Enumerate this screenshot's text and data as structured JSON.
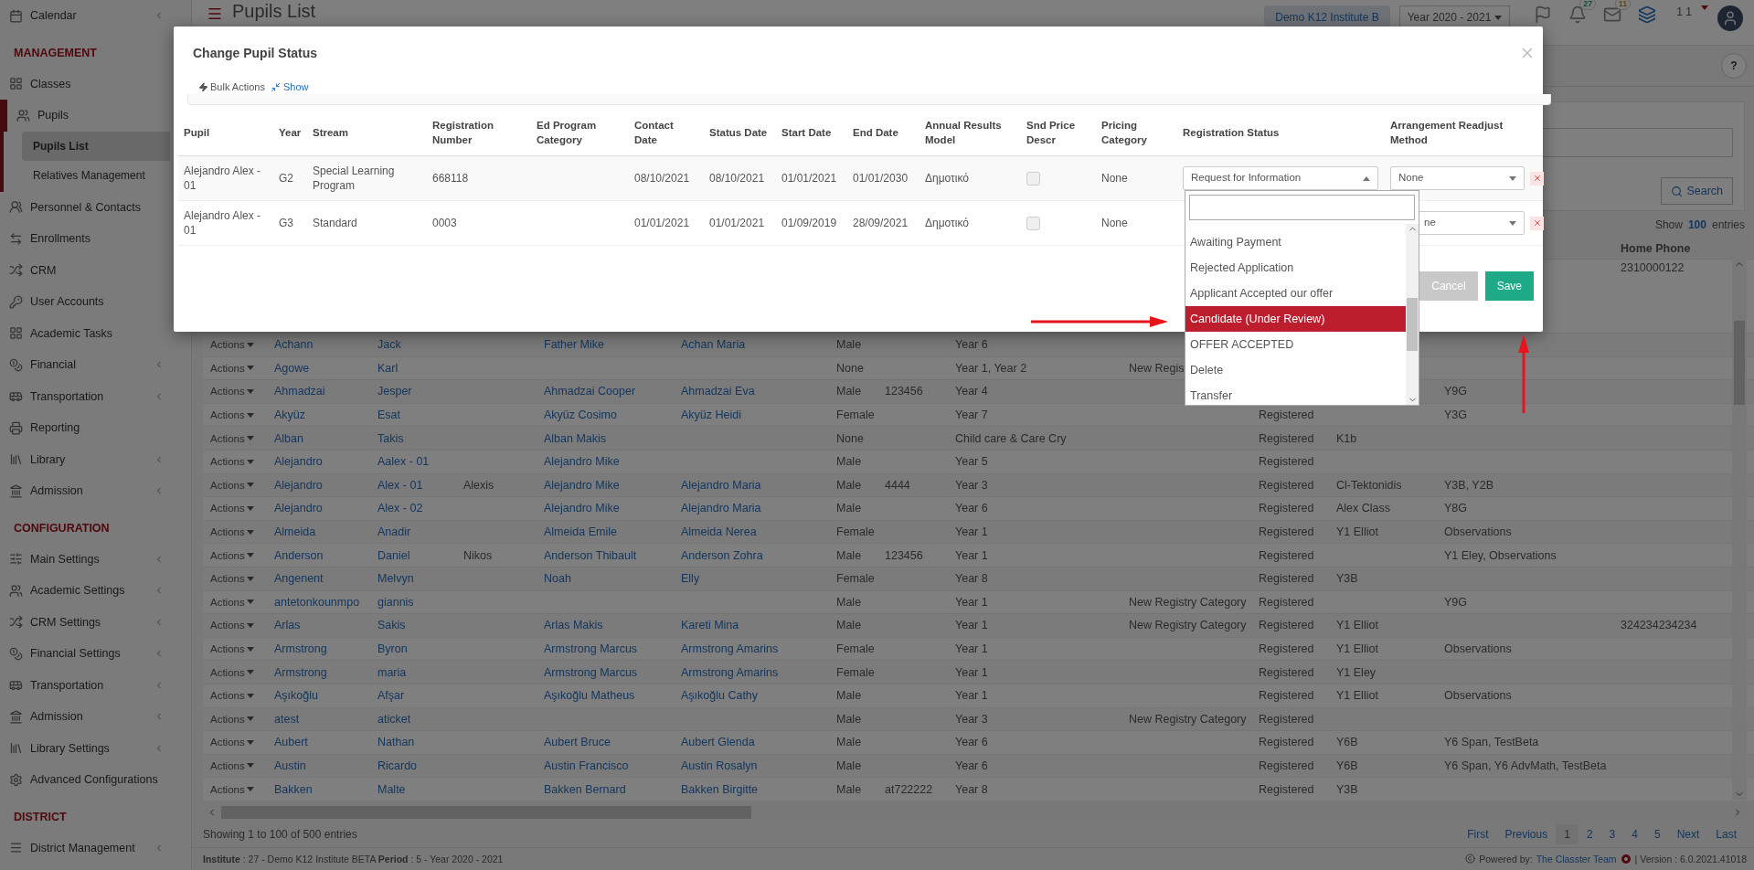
{
  "sidebar": {
    "entries": [
      {
        "kind": "item",
        "label": "Calendar",
        "submenu": true,
        "expanded": false
      },
      {
        "kind": "heading",
        "label": "MANAGEMENT"
      },
      {
        "kind": "item",
        "label": "Classes",
        "submenu": false,
        "expanded": false
      },
      {
        "kind": "item",
        "label": "Pupils",
        "submenu": false,
        "expanded": true,
        "children": [
          {
            "label": "Pupils List",
            "selected": true
          },
          {
            "label": "Relatives Management",
            "selected": false
          }
        ]
      },
      {
        "kind": "item",
        "label": "Personnel & Contacts",
        "submenu": false,
        "expanded": false
      },
      {
        "kind": "item",
        "label": "Enrollments",
        "submenu": false,
        "expanded": false
      },
      {
        "kind": "item",
        "label": "CRM",
        "submenu": false,
        "expanded": false
      },
      {
        "kind": "item",
        "label": "User Accounts",
        "submenu": false,
        "expanded": false
      },
      {
        "kind": "item",
        "label": "Academic Tasks",
        "submenu": false,
        "expanded": false
      },
      {
        "kind": "item",
        "label": "Financial",
        "submenu": true,
        "expanded": false
      },
      {
        "kind": "item",
        "label": "Transportation",
        "submenu": true,
        "expanded": false
      },
      {
        "kind": "item",
        "label": "Reporting",
        "submenu": false,
        "expanded": false
      },
      {
        "kind": "item",
        "label": "Library",
        "submenu": true,
        "expanded": false
      },
      {
        "kind": "item",
        "label": "Admission",
        "submenu": true,
        "expanded": false
      },
      {
        "kind": "heading",
        "label": "CONFIGURATION"
      },
      {
        "kind": "item",
        "label": "Main Settings",
        "submenu": true,
        "expanded": false
      },
      {
        "kind": "item",
        "label": "Academic Settings",
        "submenu": true,
        "expanded": false
      },
      {
        "kind": "item",
        "label": "CRM Settings",
        "submenu": true,
        "expanded": false
      },
      {
        "kind": "item",
        "label": "Financial Settings",
        "submenu": true,
        "expanded": false
      },
      {
        "kind": "item",
        "label": "Transportation",
        "submenu": true,
        "expanded": false
      },
      {
        "kind": "item",
        "label": "Admission",
        "submenu": true,
        "expanded": false
      },
      {
        "kind": "item",
        "label": "Library Settings",
        "submenu": true,
        "expanded": false
      },
      {
        "kind": "item",
        "label": "Advanced Configurations",
        "submenu": false,
        "expanded": false
      },
      {
        "kind": "heading",
        "label": "DISTRICT"
      },
      {
        "kind": "item",
        "label": "District Management",
        "submenu": true,
        "expanded": false
      }
    ]
  },
  "header": {
    "title": "Pupils List",
    "institute": "Demo K12 Institute B",
    "year": "Year 2020 - 2021",
    "notifications": "27",
    "messages": "11",
    "user": "1 1",
    "help": "?"
  },
  "search": {
    "button": "Search"
  },
  "page_size": {
    "prefix": "Show",
    "value": "100",
    "suffix": "entries"
  },
  "table": {
    "home_phone_heading": "Home Phone",
    "rows": [
      {
        "home_phone": "2310000122"
      },
      {
        "column_1": "Actions",
        "column_2": "Achann",
        "column_3": "Jack",
        "column_5": "Father Mike",
        "column_6": "Achan Maria",
        "column_7": "Male",
        "column_9": "Year 6"
      },
      {
        "column_1": "Actions",
        "column_2": "Agowe",
        "column_3": "Karl",
        "column_7": "None",
        "column_9": "Year 1, Year 2",
        "column_10": "New Regis"
      },
      {
        "column_1": "Actions",
        "column_2": "Ahmadzai",
        "column_3": "Jesper",
        "column_5": "Ahmadzai Cooper",
        "column_6": "Ahmadzai Eva",
        "column_7": "Male",
        "column_8": "123456",
        "column_9": "Year 4",
        "column_13": "Y9G"
      },
      {
        "column_1": "Actions",
        "column_2": "Akyüz",
        "column_3": "Esat",
        "column_5": "Akyüz Cosimo",
        "column_6": "Akyüz Heidi",
        "column_7": "Female",
        "column_9": "Year 7",
        "column_11": "Registered",
        "column_13": "Y3G"
      },
      {
        "column_1": "Actions",
        "column_2": "Alban",
        "column_3": "Takis",
        "column_5": "Alban Makis",
        "column_7": "None",
        "column_9": "Child care & Care Cry",
        "column_11": "Registered",
        "column_12": "K1b"
      },
      {
        "column_1": "Actions",
        "column_2": "Alejandro",
        "column_3": "Aalex - 01",
        "column_5": "Alejandro Mike",
        "column_7": "Male",
        "column_9": "Year 5",
        "column_11": "Registered"
      },
      {
        "column_1": "Actions",
        "column_2": "Alejandro",
        "column_3": "Alex - 01",
        "column_4": "Alexis",
        "column_5": "Alejandro Mike",
        "column_6": "Alejandro Maria",
        "column_7": "Male",
        "column_8": "4444",
        "column_9": "Year 3",
        "column_11": "Registered",
        "column_12": "Cl-Tektonidis",
        "column_13": "Y3B, Y2B"
      },
      {
        "column_1": "Actions",
        "column_2": "Alejandro",
        "column_3": "Alex - 02",
        "column_5": "Alejandro Mike",
        "column_6": "Alejandro Maria",
        "column_7": "Male",
        "column_9": "Year 6",
        "column_11": "Registered",
        "column_12": "Alex Class",
        "column_13": "Y8G"
      },
      {
        "column_1": "Actions",
        "column_2": "Almeida",
        "column_3": "Anadir",
        "column_5": "Almeida Emile",
        "column_6": "Almeida Nerea",
        "column_7": "Female",
        "column_9": "Year 1",
        "column_11": "Registered",
        "column_12": "Y1 Elliot",
        "column_13": "Observations"
      },
      {
        "column_1": "Actions",
        "column_2": "Anderson",
        "column_3": "Daniel",
        "column_4": "Nikos",
        "column_5": "Anderson Thibault",
        "column_6": "Anderson Zohra",
        "column_7": "Male",
        "column_8": "123456",
        "column_9": "Year 1",
        "column_11": "Registered",
        "column_13": "Y1 Eley, Observations"
      },
      {
        "column_1": "Actions",
        "column_2": "Angenent",
        "column_3": "Melvyn",
        "column_5": "Noah",
        "column_6": "Elly",
        "column_7": "Female",
        "column_9": "Year 8",
        "column_11": "Registered",
        "column_12": "Y3B"
      },
      {
        "column_1": "Actions",
        "column_2": "antetonkounmpo",
        "column_3": "giannis",
        "column_7": "Male",
        "column_9": "Year 1",
        "column_10": "New Registry Category",
        "column_11": "Registered",
        "column_13": "Y9G"
      },
      {
        "column_1": "Actions",
        "column_2": "Arlas",
        "column_3": "Sakis",
        "column_5": "Arlas Makis",
        "column_6": "Kareti Mina",
        "column_7": "Male",
        "column_9": "Year 1",
        "column_10": "New Registry Category",
        "column_11": "Registered",
        "column_12": "Y1 Elliot",
        "home_phone": "324234234234"
      },
      {
        "column_1": "Actions",
        "column_2": "Armstrong",
        "column_3": "Byron",
        "column_5": "Armstrong Marcus",
        "column_6": "Armstrong Amarins",
        "column_7": "Female",
        "column_9": "Year 1",
        "column_11": "Registered",
        "column_12": "Y1 Elliot",
        "column_13": "Observations"
      },
      {
        "column_1": "Actions",
        "column_2": "Armstrong",
        "column_3": "maria",
        "column_5": "Armstrong Marcus",
        "column_6": "Armstrong Amarins",
        "column_7": "Female",
        "column_9": "Year 1",
        "column_11": "Registered",
        "column_12": "Y1 Eley"
      },
      {
        "column_1": "Actions",
        "column_2": "Aşıkoğlu",
        "column_3": "Afşar",
        "column_5": "Aşıkoğlu Matheus",
        "column_6": "Aşıkoğlu Cathy",
        "column_7": "Male",
        "column_9": "Year 1",
        "column_11": "Registered",
        "column_12": "Y1 Elliot",
        "column_13": "Observations"
      },
      {
        "column_1": "Actions",
        "column_2": "atest",
        "column_3": "aticket",
        "column_7": "Male",
        "column_9": "Year 3",
        "column_10": "New Registry Category",
        "column_11": "Registered"
      },
      {
        "column_1": "Actions",
        "column_2": "Aubert",
        "column_3": "Nathan",
        "column_5": "Aubert Bruce",
        "column_6": "Aubert Glenda",
        "column_7": "Male",
        "column_9": "Year 6",
        "column_11": "Registered",
        "column_12": "Y6B",
        "column_13": "Y6 Span, TestBeta"
      },
      {
        "column_1": "Actions",
        "column_2": "Austin",
        "column_3": "Ricardo",
        "column_5": "Austin Francisco",
        "column_6": "Austin Rosalyn",
        "column_7": "Male",
        "column_9": "Year 6",
        "column_11": "Registered",
        "column_12": "Y6B",
        "column_13": "Y6 Span, Y6 AdvMath, TestBeta"
      },
      {
        "column_1": "Actions",
        "column_2": "Bakken",
        "column_3": "Malte",
        "column_5": "Bakken Bernard",
        "column_6": "Bakken Birgitte",
        "column_7": "Male",
        "column_8": "at722222",
        "column_9": "Year 8",
        "column_11": "Registered",
        "column_12": "Y3B"
      }
    ]
  },
  "entries_info": "Showing 1 to 100 of 500 entries",
  "pagination": [
    {
      "label": "First",
      "selected": false
    },
    {
      "label": "Previous",
      "selected": false
    },
    {
      "label": "1",
      "selected": true
    },
    {
      "label": "2",
      "selected": false
    },
    {
      "label": "3",
      "selected": false
    },
    {
      "label": "4",
      "selected": false
    },
    {
      "label": "5",
      "selected": false
    },
    {
      "label": "Next",
      "selected": false
    },
    {
      "label": "Last",
      "selected": false
    }
  ],
  "footer": {
    "left": "**Institute** : 27 - Demo K12 Institute BETA **Period** : 5 - Year 2020 - 2021",
    "powered_by": "Powered by:",
    "team": "The Classter Team",
    "version": "| Version : 6.0.2021.41018"
  },
  "modal": {
    "title": "Change Pupil Status",
    "bulk_actions": {
      "label": "Bulk Actions",
      "link": "Show"
    },
    "columns": [
      "Pupil",
      "Year",
      "Stream",
      "Registration Number",
      "Ed Program Category",
      "Contact Date",
      "Status Date",
      "Start Date",
      "End Date",
      "Annual Results Model",
      "Snd Price Descr",
      "Pricing Category",
      "Registration Status",
      "Arrangement Readjust Method"
    ],
    "rows": [
      {
        "pupil": "Alejandro Alex - 01",
        "year": "G2",
        "stream": "Special Learning Program",
        "registration_number": "668118",
        "contact_date": "08/10/2021",
        "status_date": "08/10/2021",
        "start_date": "01/01/2021",
        "end_date": "01/01/2030",
        "annual_results_model": "Δημοτικό",
        "snd_price_descr": false,
        "pricing_category": "None",
        "registration_status": {
          "value": "Request for Information",
          "expanded": true
        },
        "arrangement": "None"
      },
      {
        "pupil": "Alejandro Alex - 01",
        "year": "G3",
        "stream": "Standard",
        "registration_number": "0003",
        "contact_date": "01/01/2021",
        "status_date": "01/01/2021",
        "start_date": "01/09/2019",
        "end_date": "28/09/2021",
        "annual_results_model": "Δημοτικό",
        "snd_price_descr": false,
        "pricing_category": "None",
        "arrangement": "ne"
      }
    ],
    "dropdown": {
      "options": [
        {
          "label": "Awaiting Payment",
          "selected": false
        },
        {
          "label": "Rejected Application",
          "selected": false
        },
        {
          "label": "Applicant Accepted our offer",
          "selected": false
        },
        {
          "label": "Candidate (Under Review)",
          "selected": true
        },
        {
          "label": "OFFER ACCEPTED",
          "selected": false
        },
        {
          "label": "Delete",
          "selected": false
        },
        {
          "label": "Transfer",
          "selected": false
        }
      ]
    },
    "buttons": [
      {
        "label": "Cancel",
        "kind": "cancel"
      },
      {
        "label": "Save",
        "kind": "save"
      }
    ]
  },
  "annotations": [
    {
      "kind": "right_arrow"
    },
    {
      "kind": "up_arrow"
    }
  ]
}
